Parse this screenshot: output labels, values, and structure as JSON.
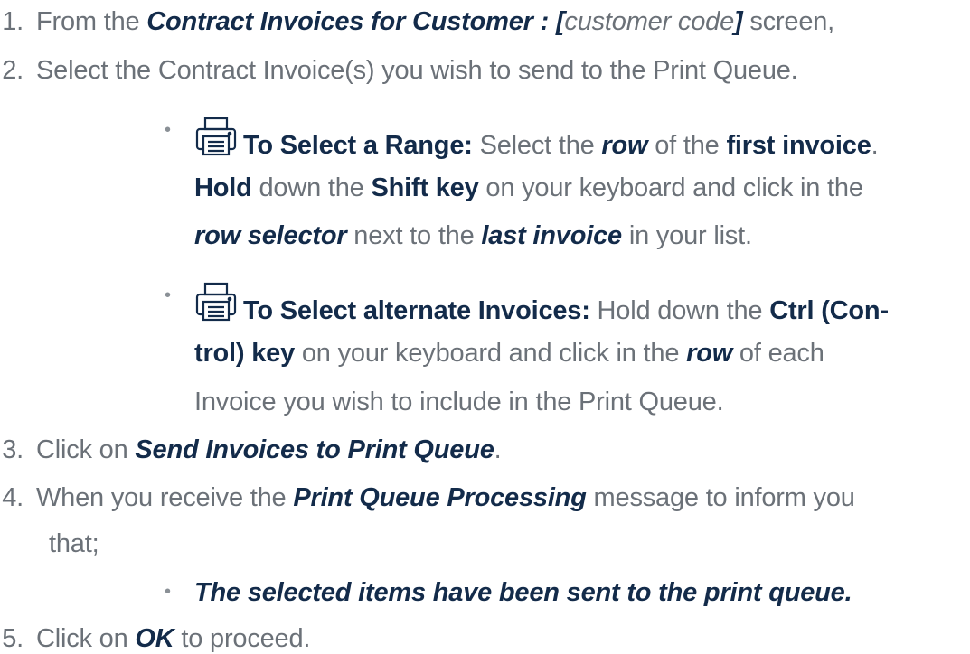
{
  "steps": [
    {
      "number": "1.",
      "prefix": "From the ",
      "screen_name": "Contract Invoices for Customer : [",
      "placeholder": "customer code",
      "screen_close": "]",
      "suffix": " screen,"
    },
    {
      "number": "2.",
      "text": "Select the Contract Invoice(s) you wish to send to the Print Queue."
    },
    {
      "number": "3.",
      "prefix": "Click on  ",
      "action": "Send Invoices to Print Queue",
      "suffix": "."
    },
    {
      "number": "4.",
      "prefix": "When you receive the ",
      "message_name": "Print Queue Processing",
      "suffix": " message to inform you",
      "continuation": "that;"
    },
    {
      "number": "5.",
      "prefix": "Click on ",
      "button": "OK",
      "suffix": " to proceed."
    }
  ],
  "tip_range": {
    "icon": "printer-icon",
    "heading": "To Select a Range:",
    "t1": " Select the ",
    "row": "row",
    "t2": " of the ",
    "first_invoice": "first invoice",
    "t3": ".",
    "hold": "Hold",
    "t4": " down the ",
    "shift_key": "Shift key",
    "t5": " on your keyboard and click in the",
    "row_selector": "row selector",
    "t6": " next to the ",
    "last_invoice": "last invoice",
    "t7": " in your list."
  },
  "tip_alternate": {
    "icon": "printer-icon",
    "heading": "To Select alternate Invoices:",
    "t1": " Hold down the ",
    "ctrl_a": "Ctrl (Con-",
    "ctrl_b": "trol) key",
    "t2": " on your keyboard and click in the ",
    "row": "row",
    "t3": " of each",
    "t4": "Invoice you wish to include in the Print Queue."
  },
  "message_bullet": "The selected items have been sent to the print queue.",
  "colors": {
    "body_text": "#6b7178",
    "emphasis": "#132b4a"
  }
}
